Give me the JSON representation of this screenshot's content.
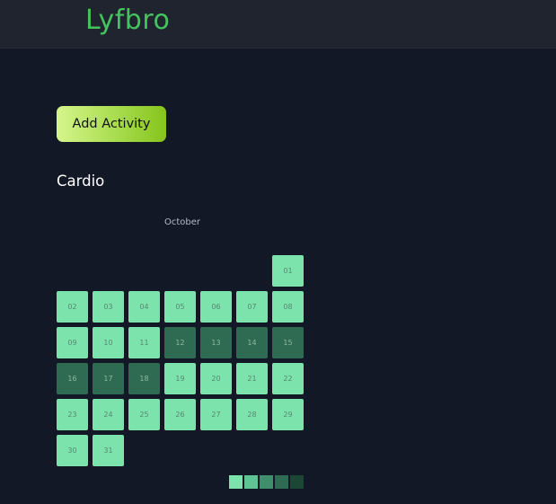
{
  "header": {
    "logo": "Lyfbro"
  },
  "actions": {
    "add_label": "Add Activity"
  },
  "section": {
    "title": "Cardio"
  },
  "calendar": {
    "month": "October",
    "start_weekday_index": 6,
    "days": [
      {
        "label": "01",
        "level": 1
      },
      {
        "label": "02",
        "level": 1
      },
      {
        "label": "03",
        "level": 1
      },
      {
        "label": "04",
        "level": 1
      },
      {
        "label": "05",
        "level": 1
      },
      {
        "label": "06",
        "level": 1
      },
      {
        "label": "07",
        "level": 1
      },
      {
        "label": "08",
        "level": 1
      },
      {
        "label": "09",
        "level": 1
      },
      {
        "label": "10",
        "level": 1
      },
      {
        "label": "11",
        "level": 1
      },
      {
        "label": "12",
        "level": 4
      },
      {
        "label": "13",
        "level": 4
      },
      {
        "label": "14",
        "level": 4
      },
      {
        "label": "15",
        "level": 4
      },
      {
        "label": "16",
        "level": 4
      },
      {
        "label": "17",
        "level": 4
      },
      {
        "label": "18",
        "level": 4
      },
      {
        "label": "19",
        "level": 1
      },
      {
        "label": "20",
        "level": 1
      },
      {
        "label": "21",
        "level": 1
      },
      {
        "label": "22",
        "level": 1
      },
      {
        "label": "23",
        "level": 1
      },
      {
        "label": "24",
        "level": 1
      },
      {
        "label": "25",
        "level": 1
      },
      {
        "label": "26",
        "level": 1
      },
      {
        "label": "27",
        "level": 1
      },
      {
        "label": "28",
        "level": 1
      },
      {
        "label": "29",
        "level": 1
      },
      {
        "label": "30",
        "level": 1
      },
      {
        "label": "31",
        "level": 1
      }
    ]
  },
  "legend": {
    "colors": [
      "#7de3ad",
      "#5fc493",
      "#3f8f6c",
      "#2f6a52",
      "#1c4636"
    ]
  }
}
